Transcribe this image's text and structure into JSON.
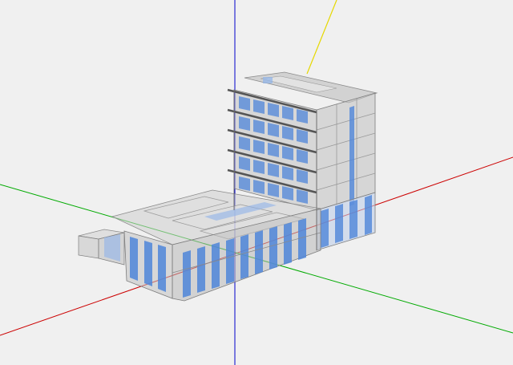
{
  "viewport": {
    "background": "#f0f0f0",
    "projection": "isometric-perspective",
    "axis_colors": {
      "x_axis": "#cc0000",
      "y_axis": "#00aa00",
      "z_axis": "#0000cc",
      "vertical_pole": "#e6d800"
    }
  },
  "model": {
    "type": "multi-storey building",
    "tower_floors": 6,
    "wing_floors": 2,
    "colors": {
      "frame": "#a8a8a8",
      "frame_edge": "#7d7d7d",
      "glass": "#4f86d9",
      "glass_light": "#8fb3ea",
      "slab": "#666666",
      "wall_fill": "#c9c9c9"
    }
  }
}
